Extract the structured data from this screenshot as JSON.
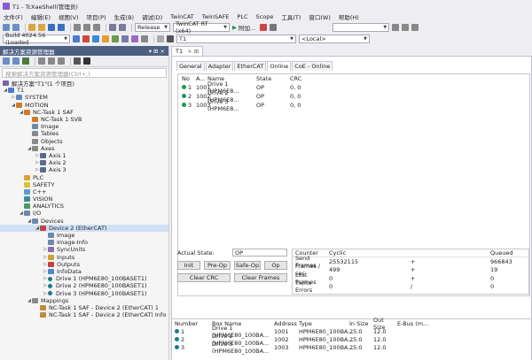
{
  "window": {
    "title": "T1 - TcXaeShell(管理员)"
  },
  "menu": [
    "文件(F)",
    "编辑(E)",
    "视图(V)",
    "项目(P)",
    "生成(B)",
    "调试(D)",
    "TwinCAT",
    "TwinSAFE",
    "PLC",
    "Scope",
    "工具(T)",
    "窗口(W)",
    "帮助(H)"
  ],
  "toolbar": {
    "config": "Release",
    "platform": "TwinCAT RT (x64)",
    "attach": "附加...",
    "build": "Build 4024.56 (Loaded",
    "target": "T1",
    "local": "<Local>"
  },
  "solution": {
    "panel_title": "解决方案资源管理器",
    "search_placeholder": "搜索解决方案资源管理器(Ctrl+;)",
    "items": [
      {
        "label": "解决方案\"T1\"(1 个项目)",
        "depth": 0
      },
      {
        "label": "T1",
        "depth": 0
      },
      {
        "label": "SYSTEM",
        "depth": 1
      },
      {
        "label": "MOTION",
        "depth": 1
      },
      {
        "label": "NC-Task 1 SAF",
        "depth": 2
      },
      {
        "label": "NC-Task 1 SVB",
        "depth": 3
      },
      {
        "label": "Image",
        "depth": 3
      },
      {
        "label": "Tables",
        "depth": 3
      },
      {
        "label": "Objects",
        "depth": 3
      },
      {
        "label": "Axes",
        "depth": 3
      },
      {
        "label": "Axis 1",
        "depth": 4
      },
      {
        "label": "Axis 2",
        "depth": 4
      },
      {
        "label": "Axis 3",
        "depth": 4
      },
      {
        "label": "PLC",
        "depth": 1
      },
      {
        "label": "SAFETY",
        "depth": 1
      },
      {
        "label": "C++",
        "depth": 1
      },
      {
        "label": "VISION",
        "depth": 1
      },
      {
        "label": "ANALYTICS",
        "depth": 1
      },
      {
        "label": "I/O",
        "depth": 1
      },
      {
        "label": "Devices",
        "depth": 2
      },
      {
        "label": "Device 2 (EtherCAT)",
        "depth": 3
      },
      {
        "label": "Image",
        "depth": 4
      },
      {
        "label": "Image-Info",
        "depth": 4
      },
      {
        "label": "SyncUnits",
        "depth": 4
      },
      {
        "label": "Inputs",
        "depth": 4
      },
      {
        "label": "Outputs",
        "depth": 4
      },
      {
        "label": "InfoData",
        "depth": 4
      },
      {
        "label": "Drive 1 (HPM6E80_100BASET1)",
        "depth": 4
      },
      {
        "label": "Drive 2 (HPM6E80_100BASET1)",
        "depth": 4
      },
      {
        "label": "Drive 3 (HPM6E80_100BASET1)",
        "depth": 4
      },
      {
        "label": "Mappings",
        "depth": 2
      },
      {
        "label": "NC-Task 1 SAF - Device 2 (EtherCAT) 1",
        "depth": 3
      },
      {
        "label": "NC-Task 1 SAF - Device 2 (EtherCAT) Info",
        "depth": 3
      }
    ]
  },
  "editor": {
    "tab": "T1",
    "subtabs": [
      "General",
      "Adapter",
      "EtherCAT",
      "Online",
      "CoE - Online"
    ],
    "devices": {
      "headers": [
        "No",
        "A...",
        "Name",
        "State",
        "CRC"
      ],
      "rows": [
        {
          "no": "1",
          "a": "1001",
          "name": "Drive 1 (HPM6E8...",
          "state": "OP",
          "crc": "0, 0"
        },
        {
          "no": "2",
          "a": "1002",
          "name": "Drive 2 (HPM6E8...",
          "state": "OP",
          "crc": "0, 0"
        },
        {
          "no": "3",
          "a": "1003",
          "name": "Drive 3 (HPM6E8...",
          "state": "OP",
          "crc": "0, 0"
        }
      ]
    },
    "actual_state_label": "Actual State:",
    "actual_state_value": "OP",
    "buttons": {
      "init": "Init",
      "preop": "Pre-Op",
      "safeop": "Safe-Op",
      "op": "Op",
      "clearcrc": "Clear CRC",
      "clearframes": "Clear Frames"
    },
    "counters": {
      "headers": [
        "Counter",
        "Cyclic",
        "",
        "Queued"
      ],
      "rows": [
        [
          "Send Frames",
          "25532115",
          "+",
          "966843"
        ],
        [
          "Frames / sec",
          "499",
          "+",
          "19"
        ],
        [
          "Lost Frames",
          "0",
          "+",
          "0"
        ],
        [
          "Tx/Rx Errors",
          "0",
          "/",
          "0"
        ]
      ]
    },
    "boxes": {
      "headers": [
        "Number",
        "Box Name",
        "Address",
        "Type",
        "In Size",
        "Out Size",
        "E-Bus (m..."
      ],
      "rows": [
        [
          "1",
          "Drive 1 (HPM6E80_100BA...",
          "1001",
          "HPM6E80_100BA...",
          "25.0",
          "12.0",
          ""
        ],
        [
          "2",
          "Drive 2 (HPM6E80_100BA...",
          "1002",
          "HPM6E80_100BA...",
          "25.0",
          "12.0",
          ""
        ],
        [
          "3",
          "Drive 3 (HPM6E80_100BA...",
          "1003",
          "HPM6E80_100BA...",
          "25.0",
          "12.0",
          ""
        ]
      ]
    }
  },
  "colors": {
    "panel_title_bg": "#4d6082",
    "selection_bg": "#cfe0f5",
    "status_green": "#1a9a4a"
  }
}
